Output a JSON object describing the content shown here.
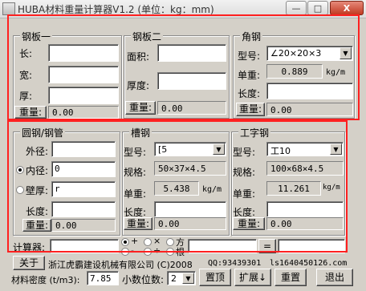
{
  "window": {
    "title": "HUBA材料重量计算器V1.2 (单位：kg：mm)",
    "minimize": "—",
    "maximize": "□",
    "close": "X"
  },
  "steel_plate_1": {
    "title": "钢板一",
    "length_label": "长:",
    "width_label": "宽:",
    "thickness_label": "厚:",
    "length": "",
    "width": "",
    "thickness": "",
    "weight_button": "重量:",
    "weight": "0.00"
  },
  "steel_plate_2": {
    "title": "钢板二",
    "area_label": "面积:",
    "thickness_label": "厚度:",
    "area": "",
    "thickness": "",
    "weight_button": "重量:",
    "weight": "0.00"
  },
  "angle_steel": {
    "title": "角钢",
    "model_label": "型号:",
    "model": "∠20×20×3",
    "unit_weight_label": "单重:",
    "unit_weight": "0.889",
    "unit": "kg/m",
    "length_label": "长度:",
    "length": "",
    "weight_button": "重量:",
    "weight": "0.00"
  },
  "pipe": {
    "title": "圆钢/钢管",
    "outer_label": "外径:",
    "outer": "",
    "inner_label": "内径:",
    "inner": "0",
    "wall_label": "壁厚:",
    "wall": "r",
    "selected_mode": "inner",
    "length_label": "长度:",
    "length": "",
    "weight_button": "重量:",
    "weight": "0.00"
  },
  "channel": {
    "title": "槽钢",
    "model_label": "型号:",
    "model": "[5",
    "spec_label": "规格:",
    "spec": "50×37×4.5",
    "unit_weight_label": "单重:",
    "unit_weight": "5.438",
    "unit": "kg/m",
    "length_label": "长度:",
    "length": "",
    "weight_button": "重量:",
    "weight": "0.00"
  },
  "ibeam": {
    "title": "工字钢",
    "model_label": "型号:",
    "model": "工10",
    "spec_label": "规格:",
    "spec": "100×68×4.5",
    "unit_weight_label": "单重:",
    "unit_weight": "11.261",
    "unit": "kg/m",
    "length_label": "长度:",
    "length": "",
    "weight_button": "重量:",
    "weight": "0.00"
  },
  "calculator": {
    "label": "计算器:",
    "op_plus": "+",
    "op_times": "×",
    "op_power": "方",
    "op_minus": "-",
    "op_divide": "÷",
    "op_root": "根",
    "equals": "="
  },
  "footer": {
    "about_button": "关于",
    "company": "浙江虎霸建设机械有限公司 (C)2008",
    "qq": "QQ:93439301",
    "email": "ls1640450126.com",
    "density_label": "材料密度 (t/m3):",
    "density": "7.85",
    "decimals_label": "小数位数:",
    "decimals": "2",
    "top_button": "置顶",
    "expand_button": "扩展↓",
    "reset_button": "重置",
    "exit_button": "退出"
  }
}
